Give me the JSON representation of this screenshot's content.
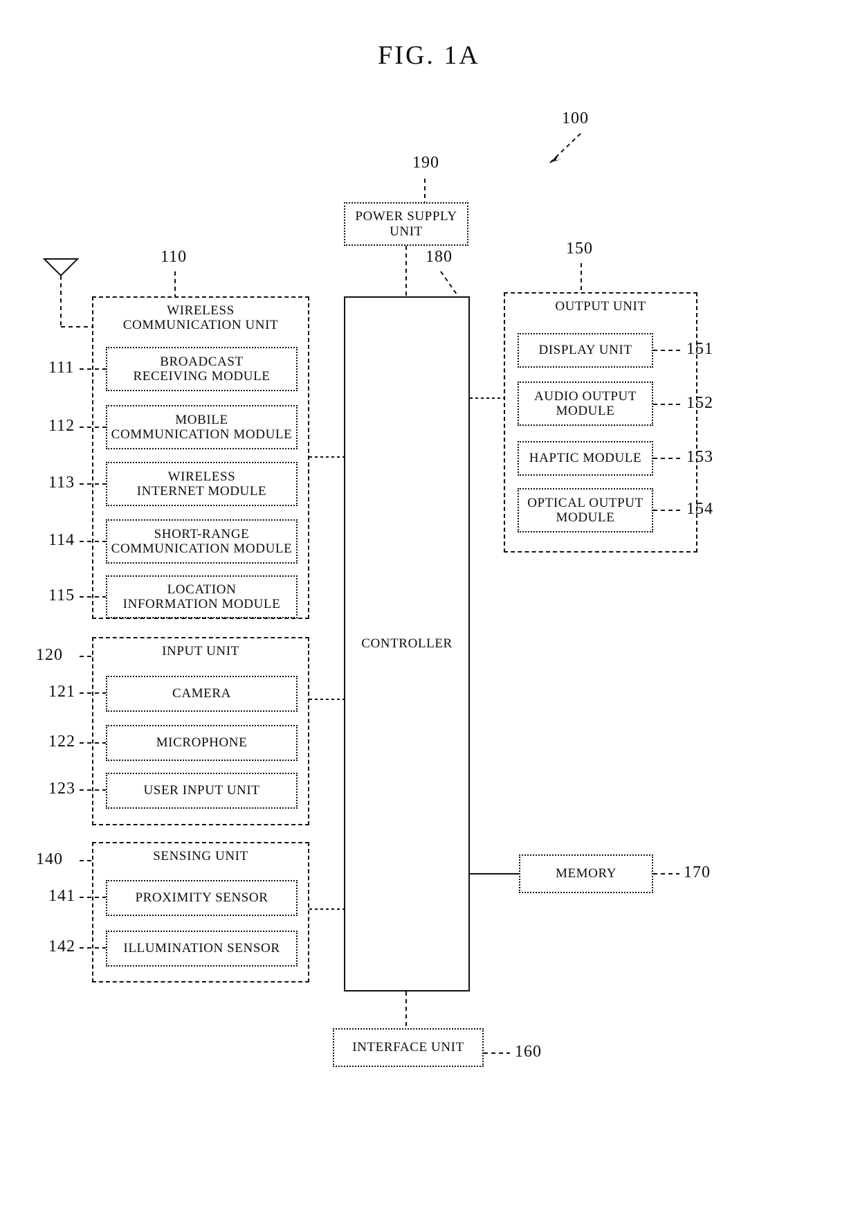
{
  "figure": {
    "title": "FIG. 1A",
    "device_ref": "100"
  },
  "power_supply": {
    "ref": "190",
    "label": "POWER SUPPLY\nUNIT"
  },
  "controller": {
    "ref": "180",
    "label": "CONTROLLER"
  },
  "wireless_communication_unit": {
    "ref": "110",
    "label": "WIRELESS\nCOMMUNICATION UNIT",
    "modules": [
      {
        "ref": "111",
        "label": "BROADCAST\nRECEIVING MODULE"
      },
      {
        "ref": "112",
        "label": "MOBILE\nCOMMUNICATION MODULE"
      },
      {
        "ref": "113",
        "label": "WIRELESS\nINTERNET MODULE"
      },
      {
        "ref": "114",
        "label": "SHORT-RANGE\nCOMMUNICATION MODULE"
      },
      {
        "ref": "115",
        "label": "LOCATION\nINFORMATION MODULE"
      }
    ]
  },
  "input_unit": {
    "ref": "120",
    "label": "INPUT UNIT",
    "modules": [
      {
        "ref": "121",
        "label": "CAMERA"
      },
      {
        "ref": "122",
        "label": "MICROPHONE"
      },
      {
        "ref": "123",
        "label": "USER INPUT UNIT"
      }
    ]
  },
  "sensing_unit": {
    "ref": "140",
    "label": "SENSING UNIT",
    "modules": [
      {
        "ref": "141",
        "label": "PROXIMITY SENSOR"
      },
      {
        "ref": "142",
        "label": "ILLUMINATION SENSOR"
      }
    ]
  },
  "output_unit": {
    "ref": "150",
    "label": "OUTPUT UNIT",
    "modules": [
      {
        "ref": "151",
        "label": "DISPLAY UNIT"
      },
      {
        "ref": "152",
        "label": "AUDIO OUTPUT\nMODULE"
      },
      {
        "ref": "153",
        "label": "HAPTIC MODULE"
      },
      {
        "ref": "154",
        "label": "OPTICAL OUTPUT\nMODULE"
      }
    ]
  },
  "memory": {
    "ref": "170",
    "label": "MEMORY"
  },
  "interface_unit": {
    "ref": "160",
    "label": "INTERFACE UNIT"
  },
  "antenna": {
    "icon": "antenna-icon"
  },
  "colors": {
    "ink": "#0d0d0d",
    "background": "#ffffff"
  }
}
